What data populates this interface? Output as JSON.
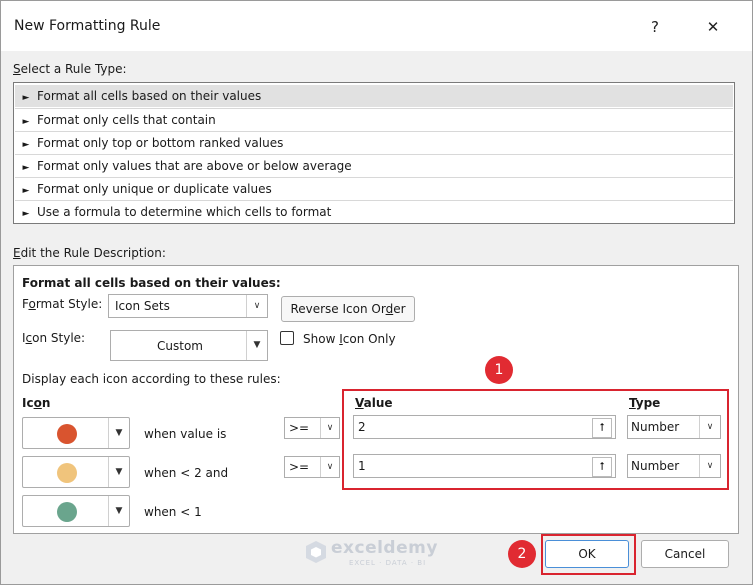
{
  "window": {
    "title": "New Formatting Rule",
    "help_glyph": "?",
    "close_glyph": "✕"
  },
  "rule_type": {
    "label_prefix": "",
    "label_mnemonic": "S",
    "label_rest": "elect a Rule Type:",
    "items": [
      {
        "label": "Format all cells based on their values",
        "selected": true
      },
      {
        "label": "Format only cells that contain",
        "selected": false
      },
      {
        "label": "Format only top or bottom ranked values",
        "selected": false
      },
      {
        "label": "Format only values that are above or below average",
        "selected": false
      },
      {
        "label": "Format only unique or duplicate values",
        "selected": false
      },
      {
        "label": "Use a formula to determine which cells to format",
        "selected": false
      }
    ],
    "arrow_glyph": "►"
  },
  "rule_description": {
    "label_mnemonic": "E",
    "label_rest": "dit the Rule Description:",
    "heading": "Format all cells based on their values:",
    "format_style": {
      "label_pre": "F",
      "label_mn": "o",
      "label_post": "rmat Style:",
      "value": "Icon Sets"
    },
    "reverse_button": {
      "pre": "Reverse Icon Or",
      "mn": "d",
      "post": "er"
    },
    "icon_style": {
      "label_pre": "I",
      "label_mn": "c",
      "label_post": "on Style:",
      "value": "Custom"
    },
    "show_icon_only": {
      "pre": "Show ",
      "mn": "I",
      "post": "con Only",
      "checked": false
    },
    "display_text": "Display each icon according to these rules:",
    "icon_header": {
      "pre": "Ic",
      "mn": "o",
      "post": "n"
    },
    "value_header": {
      "mn": "V",
      "post": "alue"
    },
    "type_header": {
      "mn": "T",
      "post": "ype"
    },
    "rules": [
      {
        "icon_color": "#d9542f",
        "icon": "red-circle-icon",
        "text": "when value is",
        "operator": ">=",
        "value": "2",
        "type": "Number"
      },
      {
        "icon_color": "#f0c47c",
        "icon": "yellow-circle-icon",
        "text": "when < 2 and",
        "operator": ">=",
        "value": "1",
        "type": "Number"
      },
      {
        "icon_color": "#6aa58d",
        "icon": "green-circle-icon",
        "text": "when < 1"
      }
    ],
    "ref_glyph": "⭡",
    "dropdown_glyph": "▼",
    "small_dropdown_glyph": "∨"
  },
  "annotations": {
    "badge1": "1",
    "badge2": "2",
    "highlight_color": "#d9242f"
  },
  "footer": {
    "ok_label": "OK",
    "cancel_label": "Cancel"
  },
  "watermark": {
    "brand": "exceldemy",
    "tagline": "EXCEL · DATA · BI"
  }
}
